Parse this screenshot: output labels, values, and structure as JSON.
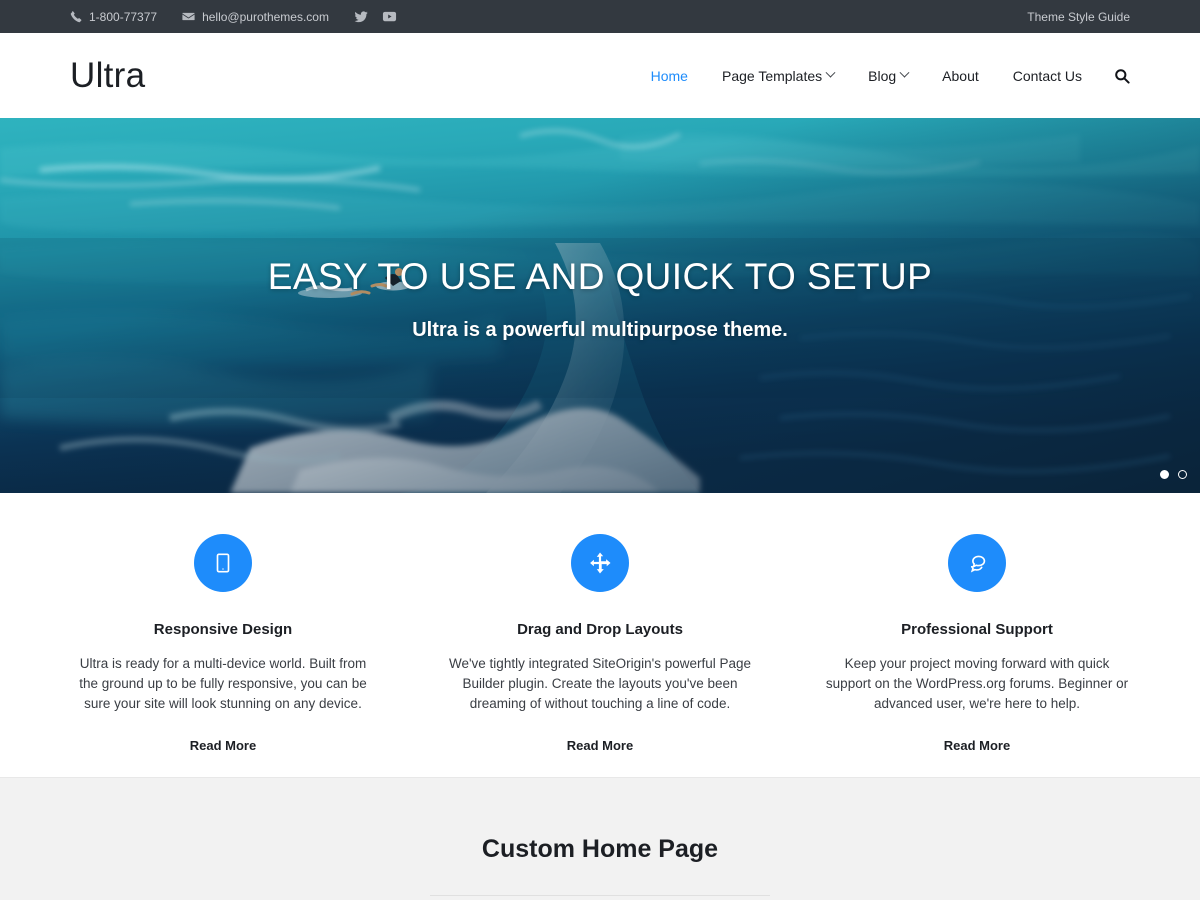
{
  "topbar": {
    "phone": "1-800-77377",
    "email": "hello@purothemes.com",
    "phone_icon": "phone-icon",
    "email_icon": "envelope-icon",
    "social": [
      {
        "name": "twitter-icon",
        "label": "Twitter"
      },
      {
        "name": "youtube-icon",
        "label": "YouTube"
      }
    ],
    "style_guide_link": "Theme Style Guide"
  },
  "header": {
    "logo": "Ultra",
    "nav": [
      {
        "label": "Home",
        "active": true,
        "has_dropdown": false
      },
      {
        "label": "Page Templates",
        "active": false,
        "has_dropdown": true
      },
      {
        "label": "Blog",
        "active": false,
        "has_dropdown": true
      },
      {
        "label": "About",
        "active": false,
        "has_dropdown": false
      },
      {
        "label": "Contact Us",
        "active": false,
        "has_dropdown": false
      }
    ],
    "search_icon": "search-icon"
  },
  "hero": {
    "title": "EASY TO USE AND QUICK TO SETUP",
    "subtitle": "Ultra is a powerful multipurpose theme.",
    "slides": [
      {
        "active": true
      },
      {
        "active": false
      }
    ]
  },
  "features": [
    {
      "icon": "tablet-icon",
      "title": "Responsive Design",
      "description": "Ultra is ready for a multi-device world. Built from the ground up to be fully responsive, you can be sure your site will look stunning on any device.",
      "link": "Read More"
    },
    {
      "icon": "move-arrows-icon",
      "title": "Drag and Drop Layouts",
      "description": "We've tightly integrated SiteOrigin's powerful Page Builder plugin. Create the layouts you've been dreaming of without touching a line of code.",
      "link": "Read More"
    },
    {
      "icon": "comments-icon",
      "title": "Professional Support",
      "description": "Keep your project moving forward with quick support on the WordPress.org forums. Beginner or advanced user, we're here to help.",
      "link": "Read More"
    }
  ],
  "custom_section": {
    "title": "Custom Home Page"
  },
  "colors": {
    "accent": "#1e8cfb",
    "topbar_bg": "#333940",
    "text": "#1c1f24",
    "section_bg": "#f2f2f2"
  }
}
